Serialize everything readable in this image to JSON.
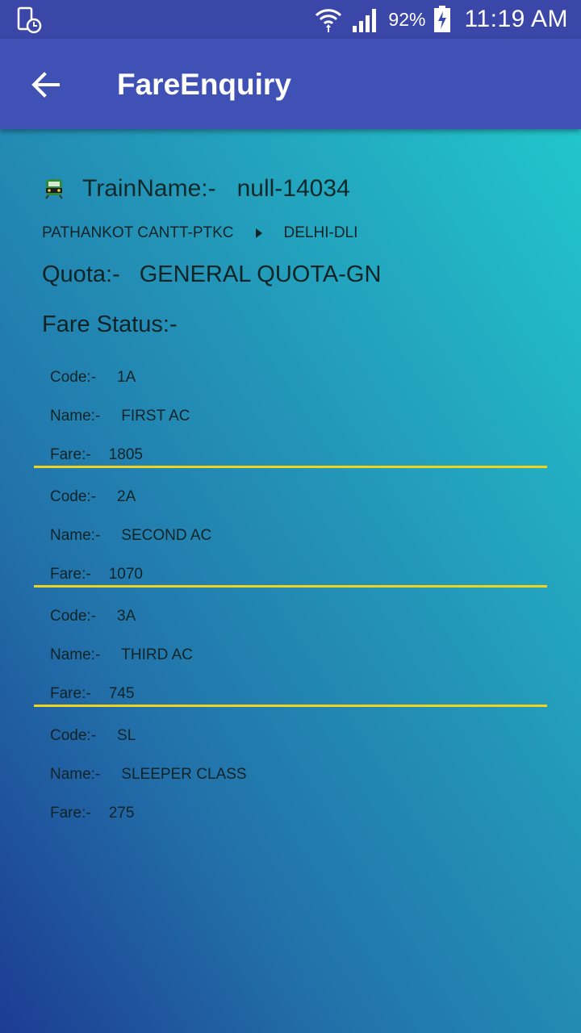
{
  "status_bar": {
    "battery_percent": "92%",
    "time": "11:19 AM",
    "icons": [
      "phone-clock-icon",
      "wifi-icon",
      "signal-icon",
      "battery-charging-icon"
    ]
  },
  "app_bar": {
    "title": "FareEnquiry",
    "back_icon": "arrow-left-icon"
  },
  "train": {
    "label": "TrainName:-",
    "value": "null-14034",
    "icon": "train-icon"
  },
  "route": {
    "from": "PATHANKOT CANTT-PTKC",
    "to": "DELHI-DLI",
    "arrow_icon": "triangle-right-icon"
  },
  "quota": {
    "label": "Quota:-",
    "value": "GENERAL QUOTA-GN"
  },
  "fare_status_label": "Fare Status:-",
  "fares": [
    {
      "code_label": "Code:-",
      "code": "1A",
      "name_label": "Name:-",
      "name": "FIRST AC",
      "fare_label": "Fare:-",
      "fare": "1805"
    },
    {
      "code_label": "Code:-",
      "code": "2A",
      "name_label": "Name:-",
      "name": "SECOND AC",
      "fare_label": "Fare:-",
      "fare": "1070"
    },
    {
      "code_label": "Code:-",
      "code": "3A",
      "name_label": "Name:-",
      "name": "THIRD AC",
      "fare_label": "Fare:-",
      "fare": "745"
    },
    {
      "code_label": "Code:-",
      "code": "SL",
      "name_label": "Name:-",
      "name": "SLEEPER CLASS",
      "fare_label": "Fare:-",
      "fare": "275"
    }
  ],
  "colors": {
    "app_bar": "#3f51b5",
    "status_bar": "#3a47a8",
    "divider": "#f0d31c",
    "gradient_top": "#22c6cc",
    "gradient_bottom": "#1d3c92"
  }
}
